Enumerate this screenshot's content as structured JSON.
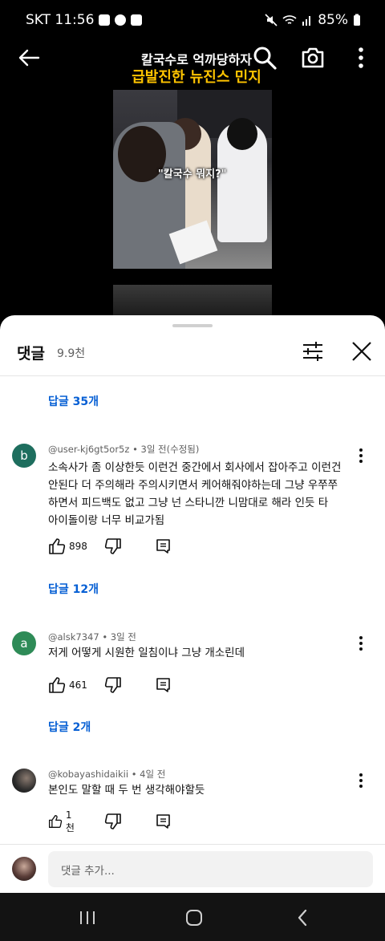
{
  "status_bar": {
    "carrier_time": "SKT 11:56",
    "battery": "85%"
  },
  "video": {
    "title_line1": "칼국수로 억까당하자",
    "title_line2": "급발진한 뉴진스 민지",
    "caption": "\"칼국수 뭐지?\""
  },
  "sheet": {
    "title": "댓글",
    "count": "9.9천"
  },
  "replies_top": "답글 35개",
  "comments": [
    {
      "avatar_letter": "b",
      "avatar_color": "#1e6e5e",
      "meta": "@user-kj6gt5or5z • 3일 전(수정됨)",
      "lines": [
        "소속사가 좀 이상한듯  이런건 중간에서 회사에서 잡아주고 이런건",
        "안된다 더 주의해라 주의시키면서 케어해줘야하는데 그냥 우쭈쭈",
        "하면서 피드백도 없고 그냥 넌 스타니깐 니맘대로 해라 인듯 타",
        "아이돌이랑 너무 비교가됨"
      ],
      "likes": "898",
      "replies": "답글 12개"
    },
    {
      "avatar_letter": "a",
      "avatar_color": "#2e8b57",
      "meta": "@alsk7347 • 3일 전",
      "lines": [
        "저게 어떻게 시원한 일침이냐 그냥 개소린데"
      ],
      "likes": "461",
      "replies": "답글 2개"
    },
    {
      "avatar_letter": "",
      "avatar_color": "#2a2a2a",
      "meta": "@kobayashidaikii • 4일 전",
      "lines": [
        "본인도 말할 때 두 번 생각해야할듯"
      ],
      "likes": "1천",
      "replies": ""
    }
  ],
  "add_comment": {
    "placeholder": "댓글 추가..."
  },
  "colors": {
    "link": "#065fd4",
    "sheet_bg": "#ffffff",
    "page_bg": "#000000"
  }
}
